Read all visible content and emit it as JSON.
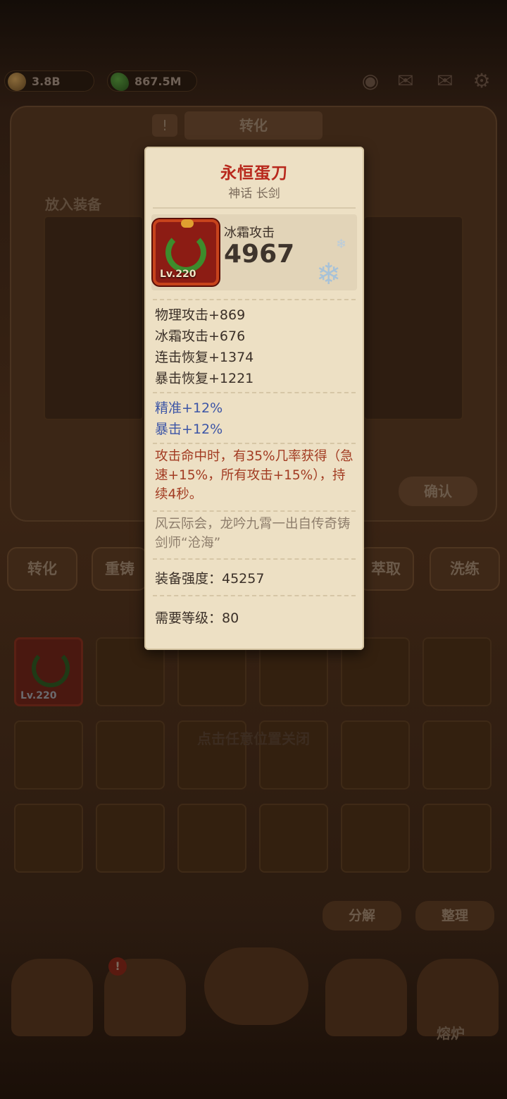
{
  "topbar": {
    "gold": "3.8B",
    "leaf": "867.5M"
  },
  "background": {
    "header_tab": "转化",
    "put_label": "放入装备",
    "confirm": "确认",
    "tabs": [
      "转化",
      "重铸",
      "萃取",
      "洗练"
    ],
    "inventory_item_level": "Lv.220",
    "close_hint": "点击任意位置关闭",
    "salvage": "分解",
    "sort": "整理",
    "nav_forge": "熔炉"
  },
  "item": {
    "name": "永恒蛋刀",
    "type": "神话 长剑",
    "level": "Lv.220",
    "main_stat": {
      "name": "冰霜攻击",
      "value": "4967"
    },
    "stats": [
      "物理攻击+869",
      "冰霜攻击+676",
      "连击恢复+1374",
      "暴击恢复+1221"
    ],
    "bonus_stats": [
      "精准+12%",
      "暴击+12%"
    ],
    "effect": "攻击命中时，有35%几率获得（急速+15%，所有攻击+15%），持续4秒。",
    "lore": "风云际会，龙吟九霄一出自传奇铸剑师“沧海”",
    "power": "装备强度：45257",
    "required_level": "需要等级：80"
  }
}
